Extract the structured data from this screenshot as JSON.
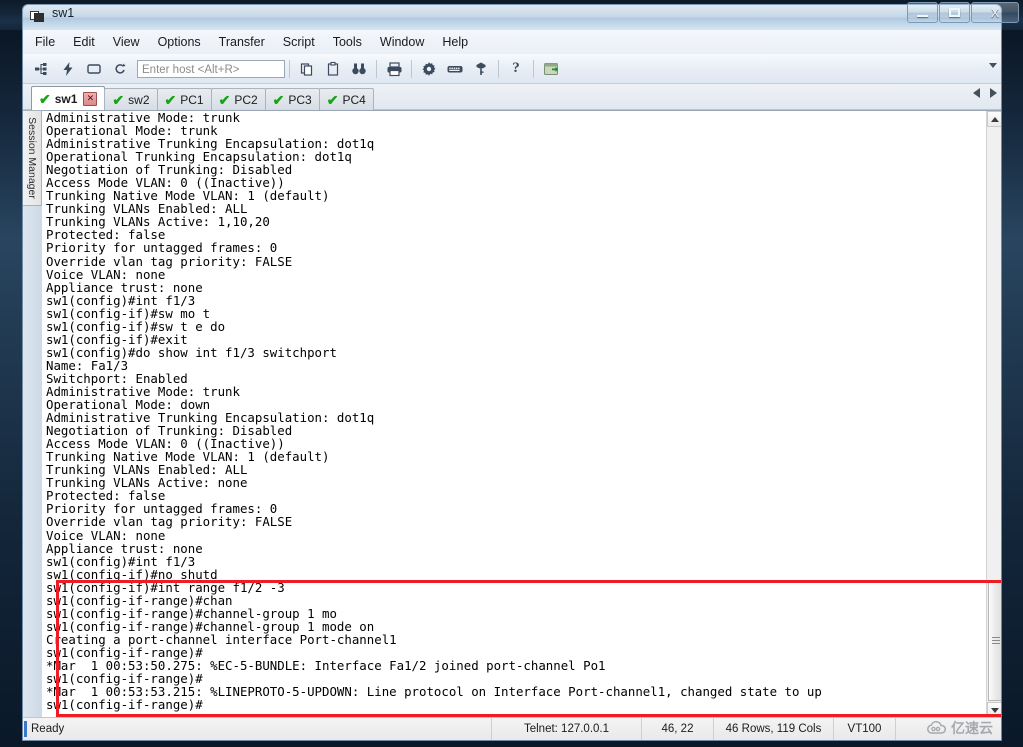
{
  "window": {
    "title": "sw1",
    "icon": "terminal-window-icon",
    "buttons": {
      "minimize": "minimize-icon",
      "maximize": "maximize-icon",
      "close": "X"
    }
  },
  "menubar": {
    "items": [
      "File",
      "Edit",
      "View",
      "Options",
      "Transfer",
      "Script",
      "Tools",
      "Window",
      "Help"
    ]
  },
  "toolbar": {
    "icons": [
      {
        "name": "connect-icon",
        "glyph": "⑂"
      },
      {
        "name": "quick-connect-icon",
        "glyph": "⚡"
      },
      {
        "name": "connect-in-tab-icon",
        "glyph": "▭"
      },
      {
        "name": "reconnect-icon",
        "glyph": "↻"
      }
    ],
    "host_placeholder": "Enter host <Alt+R>",
    "host_value": "",
    "icons2": [
      {
        "name": "copy-icon",
        "glyph": "⎘"
      },
      {
        "name": "paste-icon",
        "glyph": "⎗"
      },
      {
        "name": "find-icon",
        "glyph": "🔍"
      }
    ],
    "icons3": [
      {
        "name": "print-icon",
        "glyph": "⎙"
      }
    ],
    "icons4": [
      {
        "name": "session-options-gear-icon",
        "glyph": "⚙"
      },
      {
        "name": "keymap-keyboard-icon",
        "glyph": "⌨"
      },
      {
        "name": "key-icon",
        "glyph": "⚷"
      }
    ],
    "icons5": [
      {
        "name": "help-icon",
        "glyph": "?"
      }
    ],
    "icons6": [
      {
        "name": "sftp-tab-icon",
        "glyph": "❐"
      }
    ],
    "overflow_label": "toolbar-overflow-chevron"
  },
  "tabs": {
    "items": [
      {
        "label": "sw1",
        "active": true,
        "status": "connected",
        "closable": true
      },
      {
        "label": "sw2",
        "active": false,
        "status": "connected",
        "closable": false
      },
      {
        "label": "PC1",
        "active": false,
        "status": "connected",
        "closable": false
      },
      {
        "label": "PC2",
        "active": false,
        "status": "connected",
        "closable": false
      },
      {
        "label": "PC3",
        "active": false,
        "status": "connected",
        "closable": false
      },
      {
        "label": "PC4",
        "active": false,
        "status": "connected",
        "closable": false
      }
    ],
    "check_glyph": "✔",
    "close_glyph": "✕"
  },
  "sidebar": {
    "label": "Session Manager"
  },
  "terminal": {
    "lines": [
      "Administrative Mode: trunk",
      "Operational Mode: trunk",
      "Administrative Trunking Encapsulation: dot1q",
      "Operational Trunking Encapsulation: dot1q",
      "Negotiation of Trunking: Disabled",
      "Access Mode VLAN: 0 ((Inactive))",
      "Trunking Native Mode VLAN: 1 (default)",
      "Trunking VLANs Enabled: ALL",
      "Trunking VLANs Active: 1,10,20",
      "Protected: false",
      "Priority for untagged frames: 0",
      "Override vlan tag priority: FALSE",
      "Voice VLAN: none",
      "Appliance trust: none",
      "sw1(config)#int f1/3",
      "sw1(config-if)#sw mo t",
      "sw1(config-if)#sw t e do",
      "sw1(config-if)#exit",
      "sw1(config)#do show int f1/3 switchport",
      "Name: Fa1/3",
      "Switchport: Enabled",
      "Administrative Mode: trunk",
      "Operational Mode: down",
      "Administrative Trunking Encapsulation: dot1q",
      "Negotiation of Trunking: Disabled",
      "Access Mode VLAN: 0 ((Inactive))",
      "Trunking Native Mode VLAN: 1 (default)",
      "Trunking VLANs Enabled: ALL",
      "Trunking VLANs Active: none",
      "Protected: false",
      "Priority for untagged frames: 0",
      "Override vlan tag priority: FALSE",
      "Voice VLAN: none",
      "Appliance trust: none",
      "sw1(config)#int f1/3",
      "sw1(config-if)#no shutd",
      "sw1(config-if)#int range f1/2 -3",
      "sw1(config-if-range)#chan",
      "sw1(config-if-range)#channel-group 1 mo",
      "sw1(config-if-range)#channel-group 1 mode on",
      "Creating a port-channel interface Port-channel1",
      "sw1(config-if-range)#",
      "*Mar  1 00:53:50.275: %EC-5-BUNDLE: Interface Fa1/2 joined port-channel Po1",
      "sw1(config-if-range)#",
      "*Mar  1 00:53:53.215: %LINEPROTO-5-UPDOWN: Line protocol on Interface Port-channel1, changed state to up",
      "sw1(config-if-range)#"
    ],
    "highlight": {
      "color": "#ee1c25",
      "first_line_index": 36,
      "last_line_index": 45
    }
  },
  "statusbar": {
    "ready": "Ready",
    "protocol": "Telnet: 127.0.0.1",
    "cursor": "46,  22",
    "dimensions": "46 Rows, 119 Cols",
    "emulation": "VT100"
  },
  "watermark": {
    "text": "亿速云",
    "logo": "cloud-logo-icon"
  }
}
